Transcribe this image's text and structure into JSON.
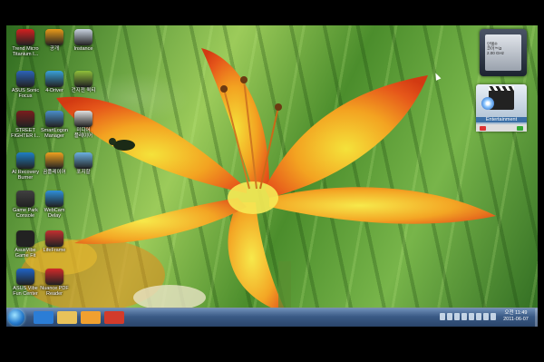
{
  "desktop": {
    "icons": [
      {
        "label": "Trend Micro\nTitanium I...",
        "color": "#d42020"
      },
      {
        "label": "공개",
        "color": "#e89a1a"
      },
      {
        "label": "Instance",
        "color": "#c9d3e0"
      },
      {
        "label": "ASUS Sonic\nFocus",
        "color": "#2c63b8"
      },
      {
        "label": "4-Driver",
        "color": "#3aa0d8"
      },
      {
        "label": "건지전 퀵티",
        "color": "#8fbf3a"
      },
      {
        "label": "STREET\nFIGHTER I...",
        "color": "#7a1d1d"
      },
      {
        "label": "SmartLogon\nManager",
        "color": "#4a8ec9"
      },
      {
        "label": "미디어\n플레이어",
        "color": "#e0e0e0"
      },
      {
        "label": "AI Recovery\nBurner",
        "color": "#1f7fc4"
      },
      {
        "label": "곰플레이어",
        "color": "#f0a020"
      },
      {
        "label": "포지할",
        "color": "#6bb0e0"
      },
      {
        "label": "Game Park\nConsole",
        "color": "#404040"
      },
      {
        "label": "WebCam\nDelay",
        "color": "#2f8fd9"
      },
      {
        "label": "AsusVibe\nGame Fit",
        "color": "#222222"
      },
      {
        "label": "LifeFrame",
        "color": "#c23030"
      },
      {
        "label": "ASUS Vibe\nFun Center",
        "color": "#1f64c8"
      },
      {
        "label": "Nuance PDF\nReader",
        "color": "#d12a2a"
      }
    ],
    "gadgets": {
      "cpu_text": "인텔®\n코어™i3\n2.00 GHz",
      "entertainment_label": "Entertainment"
    }
  },
  "taskbar": {
    "pinned": [
      {
        "name": "ie",
        "color": "#2b7dd6"
      },
      {
        "name": "explorer",
        "color": "#e8c25a"
      },
      {
        "name": "media-player",
        "color": "#f0a030"
      },
      {
        "name": "media-center",
        "color": "#d23b2b"
      }
    ],
    "clock": {
      "time": "오전 11:49",
      "date": "2011-06-07"
    }
  }
}
